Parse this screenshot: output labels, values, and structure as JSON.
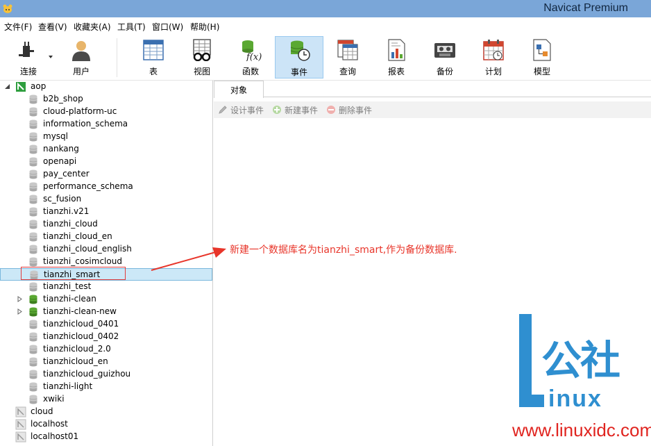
{
  "window": {
    "title": "Navicat Premium"
  },
  "menu": [
    "文件(F)",
    "查看(V)",
    "收藏夹(A)",
    "工具(T)",
    "窗口(W)",
    "帮助(H)"
  ],
  "toolbar": {
    "connect": "连接",
    "user": "用户",
    "table": "表",
    "view": "视图",
    "function": "函数",
    "event": "事件",
    "query": "查询",
    "report": "报表",
    "backup": "备份",
    "schedule": "计划",
    "model": "模型"
  },
  "tree": {
    "root": "aop",
    "databases": [
      "b2b_shop",
      "cloud-platform-uc",
      "information_schema",
      "mysql",
      "nankang",
      "openapi",
      "pay_center",
      "performance_schema",
      "sc_fusion",
      "tianzhi.v21",
      "tianzhi_cloud",
      "tianzhi_cloud_en",
      "tianzhi_cloud_english",
      "tianzhi_cosimcloud",
      "tianzhi_smart",
      "tianzhi_test",
      "tianzhi-clean",
      "tianzhi-clean-new",
      "tianzhicloud_0401",
      "tianzhicloud_0402",
      "tianzhicloud_2.0",
      "tianzhicloud_en",
      "tianzhicloud_guizhou",
      "tianzhi-light",
      "xwiki"
    ],
    "connections": [
      "cloud",
      "localhost",
      "localhost01"
    ]
  },
  "object_panel": {
    "tab": "对象",
    "design_event": "设计事件",
    "new_event": "新建事件",
    "delete_event": "删除事件"
  },
  "annotation": "新建一个数据库名为tianzhi_smart,作为备份数据库.",
  "watermark": {
    "brand": "公社",
    "linux": "inux",
    "url": "www.linuxidc.com"
  },
  "colors": {
    "titlebar": "#7aa6d8",
    "selection": "#cce8f7",
    "annotation_red": "#e8352a",
    "watermark_blue": "#2f8fd0",
    "db_green": "#5aa832"
  }
}
